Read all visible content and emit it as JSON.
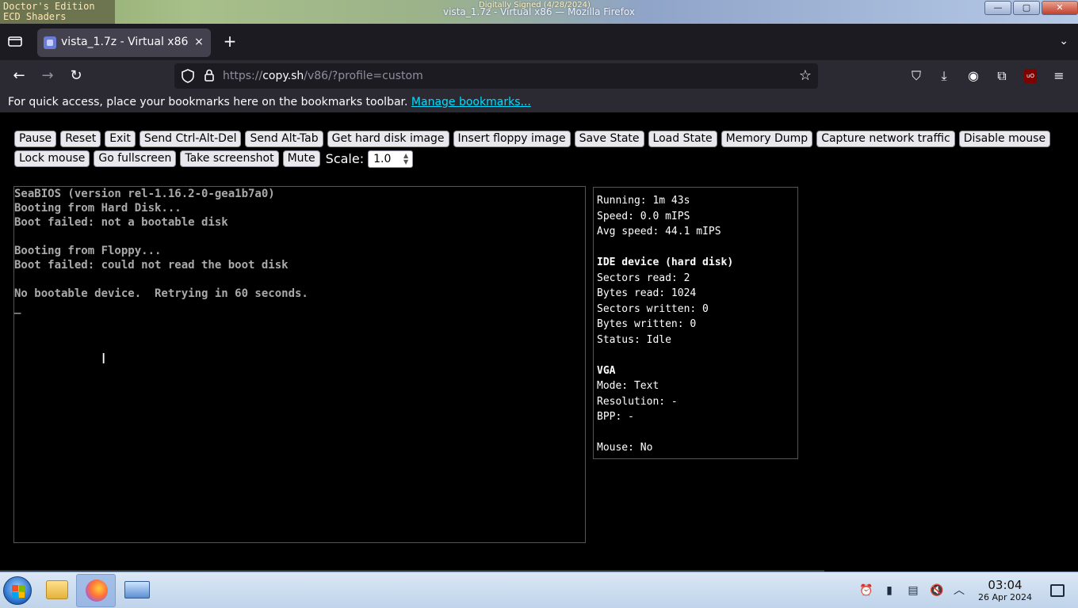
{
  "window": {
    "title": "vista_1.7z - Virtual x86 — Mozilla Firefox",
    "badge_line1": "Doctor's Edition",
    "badge_line2": "ECD Shaders",
    "signed": "Digitally Signed (4/28/2024)",
    "minimize": "—",
    "maximize": "▢",
    "close": "✕"
  },
  "tabs": {
    "list_all_icon": "tab-list-icon",
    "active_tab_title": "vista_1.7z - Virtual x86",
    "close": "×",
    "new_tab": "+",
    "tab_menu": "⌄"
  },
  "navbar": {
    "back": "←",
    "forward": "→",
    "reload": "↻",
    "url_prefix": "https://",
    "url_host": "copy.sh",
    "url_path": "/v86/?profile=custom",
    "star": "☆",
    "pocket": "⛉",
    "downloads": "⤓",
    "account": "◉",
    "extensions": "⧉",
    "ublock": "uO",
    "menu": "≡"
  },
  "bookmarks": {
    "message": "For quick access, place your bookmarks here on the bookmarks toolbar. ",
    "link": "Manage bookmarks..."
  },
  "controls": {
    "row1": [
      "Pause",
      "Reset",
      "Exit",
      "Send Ctrl-Alt-Del",
      "Send Alt-Tab",
      "Get hard disk image",
      "Insert floppy image",
      "Save State",
      "Load State",
      "Memory Dump",
      "Capture network traffic",
      "Disable mouse"
    ],
    "row2": [
      "Lock mouse",
      "Go fullscreen",
      "Take screenshot",
      "Mute"
    ],
    "scale_label": "Scale:",
    "scale_value": "1.0"
  },
  "screen": {
    "text": "SeaBIOS (version rel-1.16.2-0-gea1b7a0)\nBooting from Hard Disk...\nBoot failed: not a bootable disk\n\nBooting from Floppy...\nBoot failed: could not read the boot disk\n\nNo bootable device.  Retrying in 60 seconds.\n_"
  },
  "stats": {
    "running": "Running: 1m 43s",
    "speed": "Speed: 0.0 mIPS",
    "avg_speed": "Avg speed: 44.1 mIPS",
    "ide_heading": "IDE device (hard disk)",
    "sectors_read": "Sectors read: 2",
    "bytes_read": "Bytes read: 1024",
    "sectors_written": "Sectors written: 0",
    "bytes_written": "Bytes written: 0",
    "status": "Status: Idle",
    "vga_heading": "VGA",
    "mode": "Mode: Text",
    "resolution": "Resolution: -",
    "bpp": "BPP: -",
    "mouse": "Mouse: No"
  },
  "taskbar": {
    "time": "03:04",
    "date": "26 Apr 2024",
    "tray_icons": [
      "alarm-icon",
      "battery-icon",
      "clipboard-icon",
      "volume-muted-icon",
      "chevron-up-icon"
    ]
  }
}
